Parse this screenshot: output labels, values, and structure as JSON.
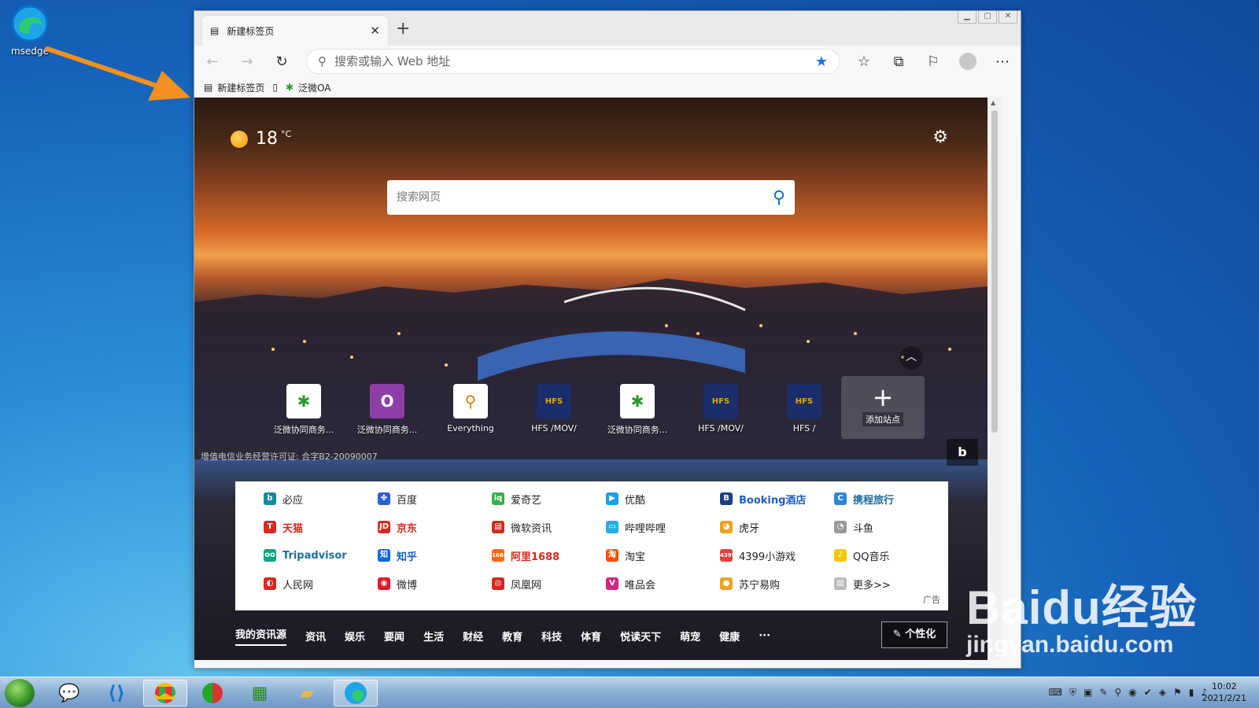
{
  "desktop": {
    "icon_label": "msedge"
  },
  "window": {
    "tab_title": "新建标签页",
    "address_placeholder": "搜索或输入 Web 地址",
    "bookmarks": [
      "新建标签页",
      "泛微OA"
    ]
  },
  "newtab": {
    "temperature": "18",
    "temperature_unit": "°C",
    "search_placeholder": "搜索网页",
    "tiles": [
      "泛微协同商务...",
      "泛微协同商务...",
      "Everything",
      "HFS /MOV/",
      "泛微协同商务...",
      "HFS /MOV/",
      "HFS /"
    ],
    "add_site_label": "添加站点",
    "license": "增值电信业务经营许可证: 合字B2-20090007",
    "links": [
      [
        "必应",
        "百度",
        "爱奇艺",
        "优酷",
        "Booking酒店",
        "携程旅行"
      ],
      [
        "天猫",
        "京东",
        "微软资讯",
        "哔哩哔哩",
        "虎牙",
        "斗鱼"
      ],
      [
        "Tripadvisor",
        "知乎",
        "阿里1688",
        "淘宝",
        "4399小游戏",
        "QQ音乐"
      ],
      [
        "人民网",
        "微博",
        "凤凰网",
        "唯品会",
        "苏宁易购",
        "更多>>"
      ]
    ],
    "ad_label": "广告",
    "news_tabs": [
      "我的资讯源",
      "资讯",
      "娱乐",
      "要闻",
      "生活",
      "财经",
      "教育",
      "科技",
      "体育",
      "悦读天下",
      "萌宠",
      "健康"
    ],
    "more_dots": "···",
    "personalize": "个性化"
  },
  "taskbar": {
    "time": "10:02",
    "date": "2021/2/21"
  },
  "watermark": {
    "logo": "Baidu经验",
    "url": "jingyan.baidu.com"
  }
}
